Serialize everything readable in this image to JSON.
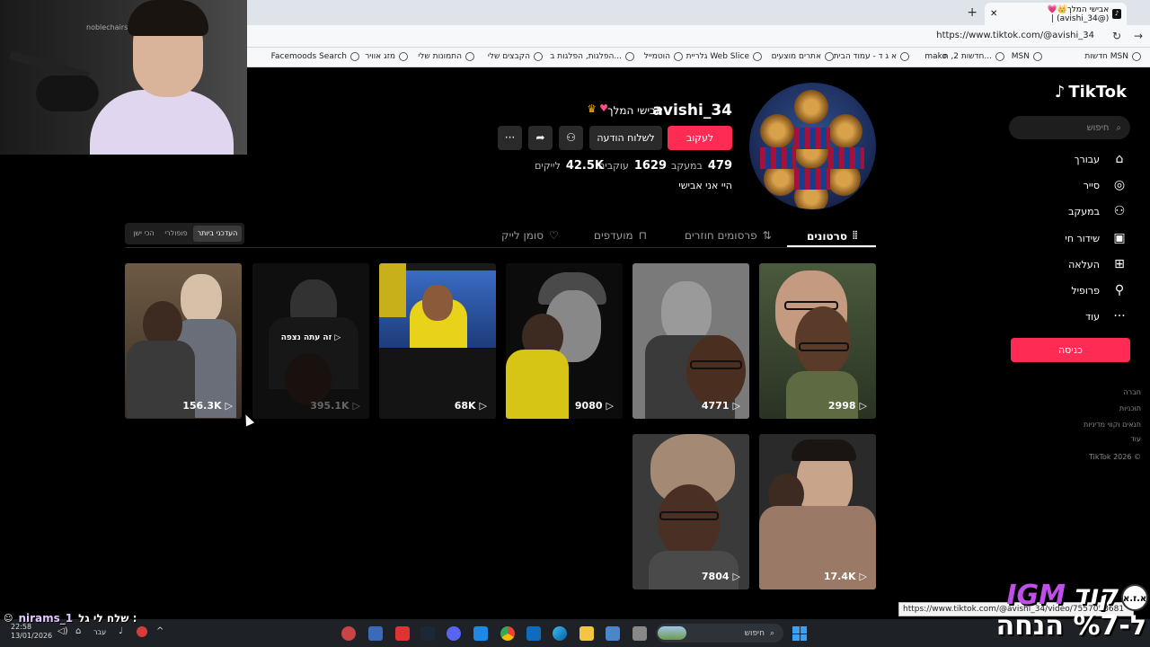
{
  "browser": {
    "tab_title": "אבישי המלך👑💗 (@avishi_34) |",
    "url": "https://www.tiktok.com/@avishi_34",
    "bookmarks": [
      "חדשות MSN",
      "MSN",
      "חדשות 2, ת...",
      "mako",
      "א ג ד - עמוד הבית",
      "אתרים מוצעים",
      "גלריית Web Slice",
      "הוטמייל",
      "הפלגות, הפלגות ב...",
      "הקבצים שלי",
      "התמונות שלי",
      "מזג אוויר",
      "Facemoods Search"
    ]
  },
  "webcam": {
    "brand": "noblechairs"
  },
  "sidebar": {
    "logo": "TikTok",
    "search_placeholder": "חיפוש",
    "nav": [
      {
        "label": "עבורך",
        "icon": "home-icon"
      },
      {
        "label": "סייר",
        "icon": "compass-icon"
      },
      {
        "label": "במעקב",
        "icon": "following-icon"
      },
      {
        "label": "שידור חי",
        "icon": "live-icon"
      },
      {
        "label": "העלאה",
        "icon": "upload-icon"
      },
      {
        "label": "פרופיל",
        "icon": "profile-icon"
      },
      {
        "label": "עוד",
        "icon": "more-icon"
      }
    ],
    "login": "כניסה",
    "footer": [
      "חברה",
      "תוכניות",
      "תנאים וקווי מדיניות",
      "עוד",
      "TikTok 2026 ©"
    ]
  },
  "profile": {
    "username": "avishi_34",
    "display_name": "אבישי המלך",
    "follow": "לעקוב",
    "message": "לשלוח הודעה",
    "more": "···",
    "stats": [
      {
        "n": "479",
        "l": "במעקב"
      },
      {
        "n": "1629",
        "l": "עוקבים"
      },
      {
        "n": "42.5K",
        "l": "לייקים"
      }
    ],
    "bio": "היי אני אבישי"
  },
  "tabs": {
    "videos": "סרטונים",
    "reposts": "פרסומים חוזרים",
    "favorites": "מועדפים",
    "liked": "סומן לייק",
    "sort": [
      "העדכני ביותר",
      "פופולרי",
      "הכי ישן"
    ]
  },
  "videos": [
    {
      "count": "2998"
    },
    {
      "count": "4771"
    },
    {
      "count": "9080"
    },
    {
      "count": "68K"
    },
    {
      "count": "395.1K",
      "caption": "זה עתה נצפה"
    },
    {
      "count": "156.3K"
    },
    {
      "count": "17.4K"
    },
    {
      "count": "7804"
    }
  ],
  "tooltip": "https://www.tiktok.com/@avishi_34/video/7557058681",
  "taskbar": {
    "time": "22:58",
    "date": "13/01/2026",
    "lang": "עבר",
    "search": "חיפוש"
  },
  "overlay": {
    "chat_user": "nirams_1",
    "chat_msg": "שלח לי גל :",
    "promo_code": "קוד",
    "promo_brand": "IGM",
    "promo_line2": "ל-%7 הנחה",
    "badge": "א.ז.א"
  }
}
